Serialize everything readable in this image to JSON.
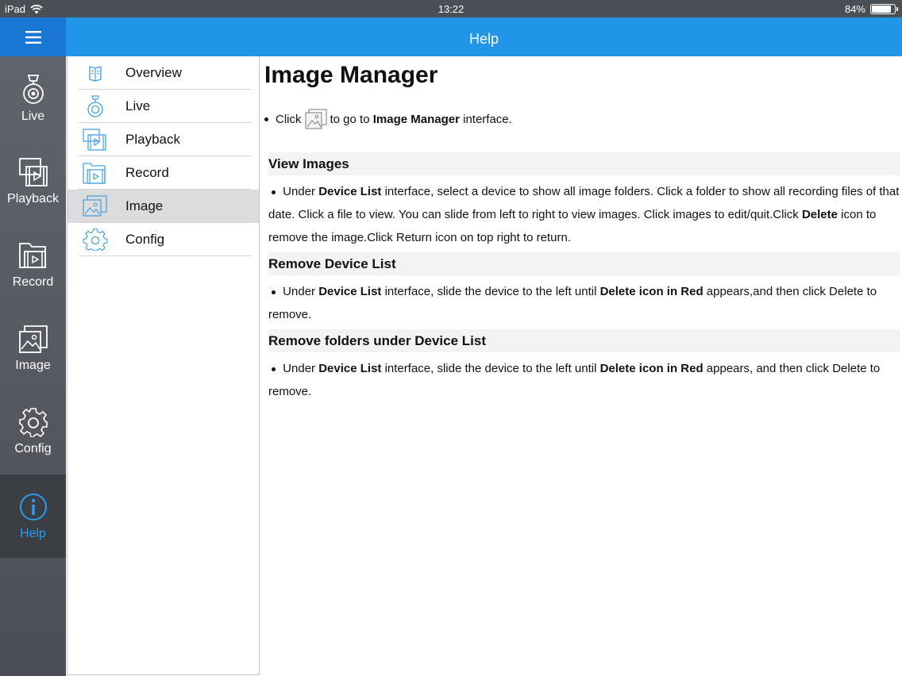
{
  "status_bar": {
    "device": "iPad",
    "time": "13:22",
    "battery": "84%",
    "battery_level": 0.84
  },
  "header": {
    "title": "Help",
    "menu_icon": "hamburger-icon"
  },
  "rail": {
    "items": [
      {
        "label": "Live",
        "icon": "camera-icon"
      },
      {
        "label": "Playback",
        "icon": "playback-icon"
      },
      {
        "label": "Record",
        "icon": "record-icon"
      },
      {
        "label": "Image",
        "icon": "image-icon"
      },
      {
        "label": "Config",
        "icon": "gear-icon"
      },
      {
        "label": "Help",
        "icon": "info-icon",
        "active": true
      }
    ]
  },
  "submenu": {
    "items": [
      {
        "label": "Overview",
        "icon": "book-icon"
      },
      {
        "label": "Live",
        "icon": "camera-icon"
      },
      {
        "label": "Playback",
        "icon": "playback-icon"
      },
      {
        "label": "Record",
        "icon": "record-icon"
      },
      {
        "label": "Image",
        "icon": "image-icon",
        "active": true
      },
      {
        "label": "Config",
        "icon": "gear-icon"
      }
    ]
  },
  "content": {
    "title": "Image Manager",
    "intro": {
      "before": "Click",
      "after": "to go to",
      "bold": "Image Manager",
      "end": "interface."
    },
    "sections": [
      {
        "heading": "View Images",
        "parts": {
          "p1": "Under",
          "b1": "Device List",
          "p2": "interface, select a device to show all image folders. Click a folder to show all recording files of that date. Click a file to view. You can slide from left to right to view images. Click images to edit/quit.Click",
          "b2": "Delete",
          "p3": "icon to remove the image.Click Return icon on top right to return."
        }
      },
      {
        "heading": "Remove Device List",
        "parts": {
          "p1": "Under",
          "b1": "Device List",
          "p2": "interface, slide the device to the left until",
          "b2": "Delete icon in Red",
          "p3": "appears,and then click Delete to remove."
        }
      },
      {
        "heading": "Remove folders under Device List",
        "parts": {
          "p1": "Under",
          "b1": "Device List",
          "p2": "interface, slide the device to the left until",
          "b2": "Delete icon in Red",
          "p3": "appears, and then click Delete to remove."
        }
      }
    ]
  },
  "colors": {
    "header_blue": "#2196e9",
    "menu_button_blue": "#1976d2",
    "rail_gray": "#585c62",
    "active_blue": "#2a9bf0",
    "submenu_active": "#dcdcdc"
  }
}
